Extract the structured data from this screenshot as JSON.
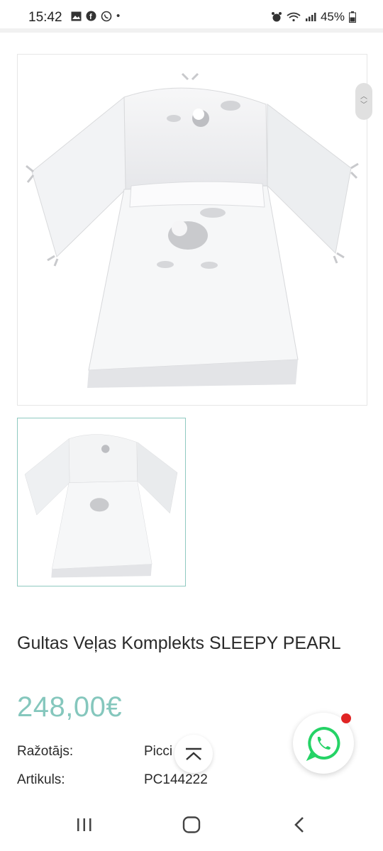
{
  "status_bar": {
    "time": "15:42",
    "dot": "•",
    "battery": "45%"
  },
  "product": {
    "title": "Gultas Veļas Komplekts SLEEPY PEARL",
    "price": "248,00€",
    "specs": [
      {
        "label": "Ražotājs:",
        "value": "Picci Best"
      },
      {
        "label": "Artikuls:",
        "value": "PC144222"
      }
    ]
  },
  "icons": {
    "status_left": [
      "gallery-icon",
      "facebook-icon",
      "viber-icon"
    ],
    "status_right": [
      "alarm-icon",
      "wifi-icon",
      "signal-icon",
      "battery-icon"
    ],
    "nav": [
      "recent-apps-icon",
      "home-icon",
      "back-icon"
    ]
  },
  "colors": {
    "price": "#85c7bd",
    "thumbnail_border": "#8fc9c0",
    "whatsapp": "#25d366",
    "notification": "#e02424"
  }
}
